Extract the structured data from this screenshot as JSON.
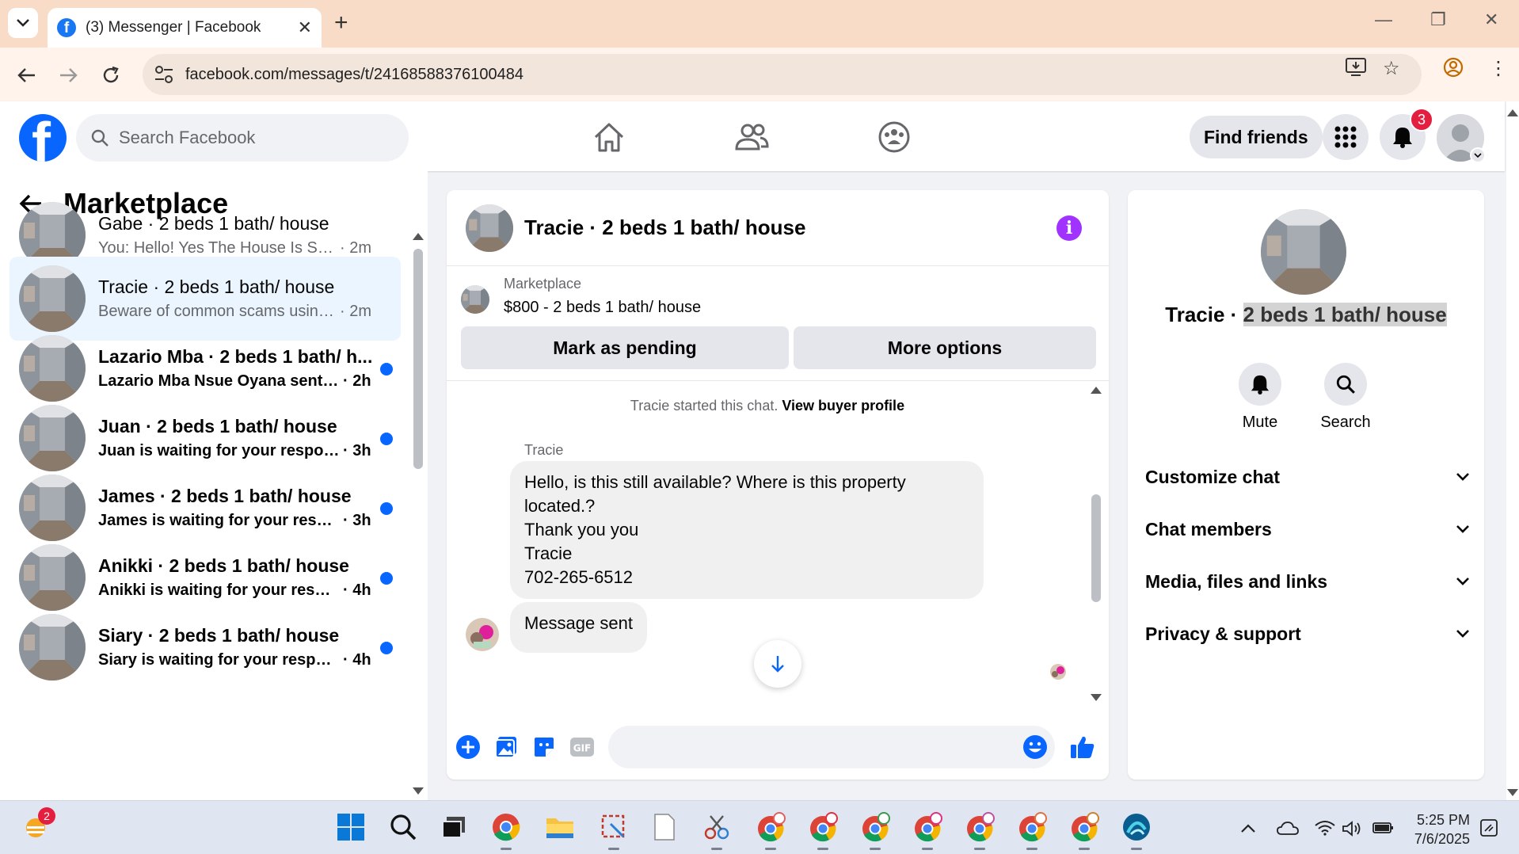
{
  "browser": {
    "tab_title": "(3) Messenger | Facebook",
    "url": "facebook.com/messages/t/24168588376100484"
  },
  "fb": {
    "search_placeholder": "Search Facebook",
    "find_friends": "Find friends",
    "notification_count": "3",
    "brand_color": "#0866ff"
  },
  "left_panel": {
    "title": "Marketplace",
    "conversations": [
      {
        "name": "Gabe · 2 beds 1 bath/ house",
        "snippet": "You: Hello! Yes The House Is Still A...",
        "time": "· 2m",
        "unread": false,
        "active": false
      },
      {
        "name": "Tracie · 2 beds 1 bath/ house",
        "snippet": "Beware of common scams using p...",
        "time": "· 2m",
        "unread": false,
        "active": true
      },
      {
        "name": "Lazario Mba · 2 beds 1 bath/ h...",
        "snippet": "Lazario Mba Nsue Oyana sent y...",
        "time": "· 2h",
        "unread": true,
        "active": false
      },
      {
        "name": "Juan · 2 beds 1 bath/ house",
        "snippet": "Juan is waiting for your response.",
        "time": "· 3h",
        "unread": true,
        "active": false
      },
      {
        "name": "James · 2 beds 1 bath/ house",
        "snippet": "James is waiting for your respo...",
        "time": "· 3h",
        "unread": true,
        "active": false
      },
      {
        "name": "Anikki · 2 beds 1 bath/ house",
        "snippet": "Anikki is waiting for your respo...",
        "time": "· 4h",
        "unread": true,
        "active": false
      },
      {
        "name": "Siary · 2 beds 1 bath/ house",
        "snippet": "Siary is waiting for your response.",
        "time": "· 4h",
        "unread": true,
        "active": false
      }
    ]
  },
  "chat": {
    "title": "Tracie · 2 beds 1 bath/ house",
    "listing_source": "Marketplace",
    "listing_price": "$800 - 2 beds 1 bath/ house",
    "mark_pending": "Mark as pending",
    "more_options": "More options",
    "started_text": "Tracie started this chat.",
    "view_buyer_profile": "View buyer profile",
    "sender": "Tracie",
    "message_lines": [
      "Hello, is this still available? Where is this property",
      "located.?",
      "Thank you you",
      "Tracie",
      "702-265-6512"
    ],
    "reply": "Message sent"
  },
  "right_panel": {
    "name_prefix": "Tracie · ",
    "name_highlight": "2 beds 1 bath/ house",
    "mute": "Mute",
    "search": "Search",
    "sections": [
      "Customize chat",
      "Chat members",
      "Media, files and links",
      "Privacy & support"
    ]
  },
  "taskbar": {
    "weather_badge": "2",
    "time": "5:25 PM",
    "date": "7/6/2025"
  }
}
